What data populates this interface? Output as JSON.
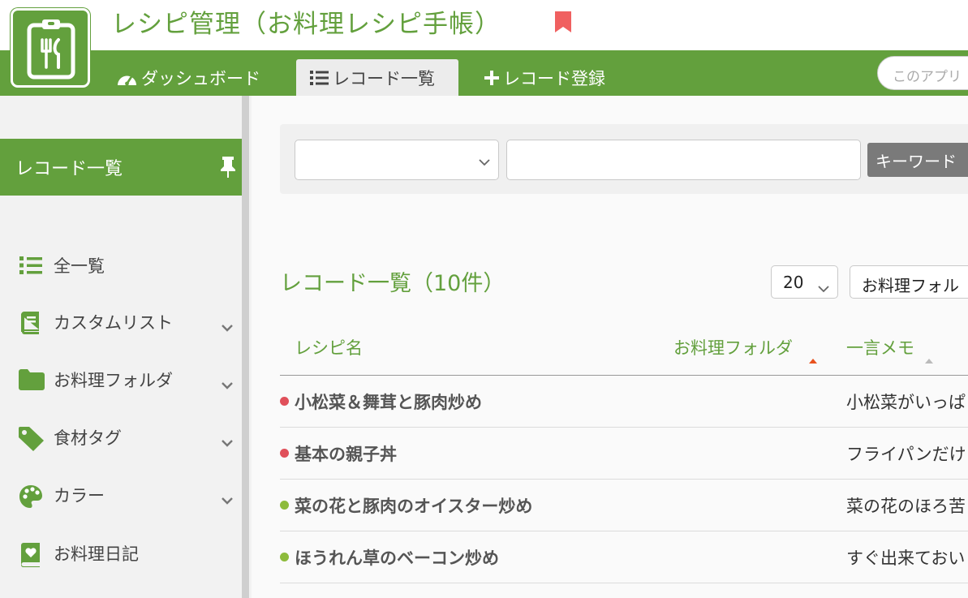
{
  "app": {
    "title": "レシピ管理（お料理レシピ手帳）",
    "search_placeholder": "このアプリ"
  },
  "nav": {
    "tabs": [
      {
        "label": "ダッシュボード"
      },
      {
        "label": "レコード一覧"
      },
      {
        "label": "レコード登録"
      }
    ]
  },
  "sidebar": {
    "header": "レコード一覧",
    "items": [
      {
        "label": "全一覧",
        "icon": "list-icon"
      },
      {
        "label": "カスタムリスト",
        "icon": "book-icon"
      },
      {
        "label": "お料理フォルダ",
        "icon": "folder-icon"
      },
      {
        "label": "食材タグ",
        "icon": "tag-icon"
      },
      {
        "label": "カラー",
        "icon": "palette-icon"
      },
      {
        "label": "お料理日記",
        "icon": "heart-book-icon"
      }
    ]
  },
  "filter": {
    "field_value": "",
    "keyword_value": "",
    "keyword_button": "キーワード"
  },
  "list": {
    "title": "レコード一覧（10件）",
    "per_page": "20",
    "folder_select": "お料理フォル"
  },
  "table": {
    "columns": [
      "レシピ名",
      "お料理フォルダ",
      "一言メモ"
    ],
    "rows": [
      {
        "name": "小松菜＆舞茸と豚肉炒め",
        "memo": "小松菜がいっぱ",
        "color": "#e0505a"
      },
      {
        "name": "基本の親子丼",
        "memo": "フライパンだけ",
        "color": "#e0505a"
      },
      {
        "name": "菜の花と豚肉のオイスター炒め",
        "memo": "菜の花のほろ苦",
        "color": "#8dbb3c"
      },
      {
        "name": "ほうれん草のベーコン炒め",
        "memo": "すぐ出来ておい",
        "color": "#8dbb3c"
      }
    ]
  },
  "colors": {
    "brand": "#63a03d",
    "bookmark": "#f06060",
    "sort_active": "#e8521e",
    "sort_inactive": "#bbbbbb"
  }
}
